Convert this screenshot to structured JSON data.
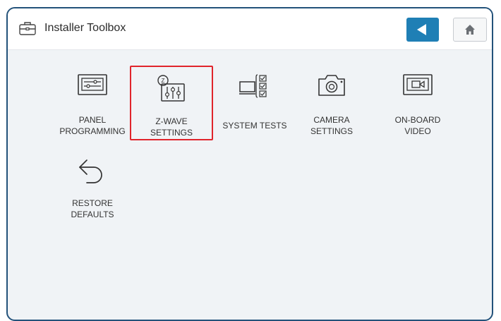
{
  "header": {
    "title": "Installer Toolbox",
    "back_icon": "back-arrow-icon",
    "home_icon": "home-icon",
    "accent_color": "#1f7fb5"
  },
  "tiles": [
    {
      "label": "PANEL\nPROGRAMMING",
      "icon": "panel-programming-icon"
    },
    {
      "label": "Z-WAVE\nSETTINGS",
      "icon": "z-wave-settings-icon",
      "selected": true
    },
    {
      "label": "SYSTEM TESTS",
      "icon": "system-tests-icon"
    },
    {
      "label": "CAMERA\nSETTINGS",
      "icon": "camera-icon"
    },
    {
      "label": "ON-BOARD\nVIDEO",
      "icon": "video-icon"
    },
    {
      "label": "RESTORE\nDEFAULTS",
      "icon": "restore-icon"
    }
  ],
  "highlight_color": "#e0242b"
}
